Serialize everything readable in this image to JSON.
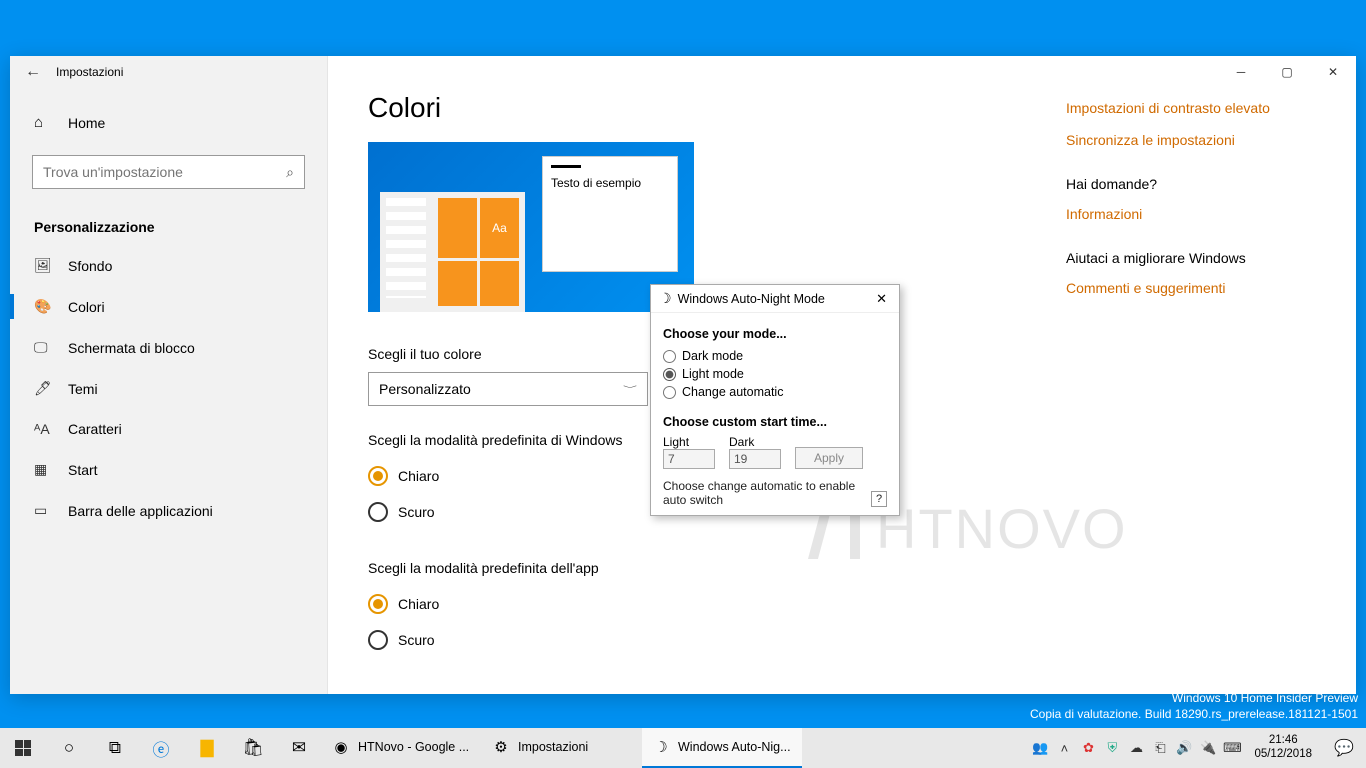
{
  "window": {
    "title": "Impostazioni"
  },
  "sidebar": {
    "home": "Home",
    "search_placeholder": "Trova un'impostazione",
    "section": "Personalizzazione",
    "items": [
      {
        "label": "Sfondo",
        "icon": "🖼"
      },
      {
        "label": "Colori",
        "icon": "🎨"
      },
      {
        "label": "Schermata di blocco",
        "icon": "🖵"
      },
      {
        "label": "Temi",
        "icon": "🖊"
      },
      {
        "label": "Caratteri",
        "icon": "ᴬA"
      },
      {
        "label": "Start",
        "icon": "▦"
      },
      {
        "label": "Barra delle applicazioni",
        "icon": "▭"
      }
    ]
  },
  "page": {
    "title": "Colori",
    "preview_tile_label": "Aa",
    "preview_sample": "Testo di esempio",
    "choose_color_label": "Scegli il tuo colore",
    "choose_color_value": "Personalizzato",
    "win_mode_label": "Scegli la modalità predefinita di Windows",
    "win_mode_options": [
      "Chiaro",
      "Scuro"
    ],
    "app_mode_label": "Scegli la modalità predefinita dell'app",
    "app_mode_options": [
      "Chiaro",
      "Scuro"
    ]
  },
  "right": {
    "contrast": "Impostazioni di contrasto elevato",
    "sync": "Sincronizza le impostazioni",
    "questions_head": "Hai domande?",
    "info": "Informazioni",
    "improve_head": "Aiutaci a migliorare Windows",
    "feedback": "Commenti e suggerimenti"
  },
  "dialog": {
    "title": "Windows Auto-Night Mode",
    "mode_head": "Choose your mode...",
    "opt_dark": "Dark mode",
    "opt_light": "Light mode",
    "opt_auto": "Change automatic",
    "time_head": "Choose custom start time...",
    "light_label": "Light",
    "light_value": "7",
    "dark_label": "Dark",
    "dark_value": "19",
    "apply": "Apply",
    "hint": "Choose change automatic to enable auto switch"
  },
  "desktop_watermark": {
    "line1": "Windows 10 Home Insider Preview",
    "line2": "Copia di valutazione. Build 18290.rs_prerelease.181121-1501"
  },
  "taskbar": {
    "apps": [
      {
        "label": "HTNovo - Google ...",
        "icon": "◉"
      },
      {
        "label": "Impostazioni",
        "icon": "⚙"
      },
      {
        "label": "Windows Auto-Nig...",
        "icon": "☽"
      }
    ],
    "time": "21:46",
    "date": "05/12/2018"
  },
  "watermark_text": "HTNOVO"
}
